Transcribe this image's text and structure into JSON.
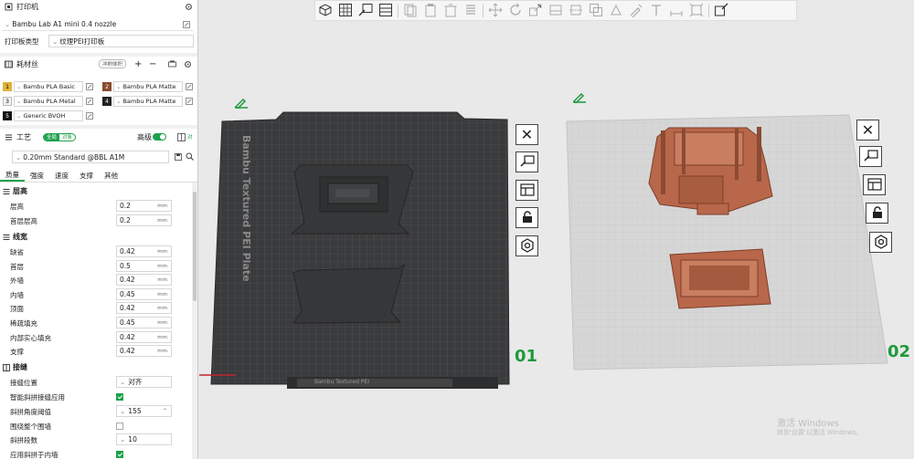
{
  "printer": {
    "title": "打印机",
    "printer_name": "Bambu Lab A1 mini 0.4 nozzle",
    "plate_type_label": "打印板类型",
    "plate_type_value": "纹理PEI打印板"
  },
  "filament": {
    "title": "耗材丝",
    "flush_badge": "冲刷体积",
    "items": [
      {
        "slot": "1",
        "name": "Bambu PLA Basic",
        "color": "#e0b33a"
      },
      {
        "slot": "2",
        "name": "Bambu PLA Matte",
        "color": "#8a4a2d"
      },
      {
        "slot": "3",
        "name": "Bambu PLA Metal",
        "color": "#f2f2f2"
      },
      {
        "slot": "4",
        "name": "Bambu PLA Matte",
        "color": "#222222"
      },
      {
        "slot": "5",
        "name": "Generic BVOH",
        "color": "#111111"
      }
    ]
  },
  "process": {
    "title": "工艺",
    "toggle_global": "全局",
    "toggle_object": "对象",
    "advanced_label": "高级",
    "profile": "0.20mm Standard @BBL A1M",
    "tabs": [
      "质量",
      "强度",
      "速度",
      "支撑",
      "其他"
    ],
    "groups": {
      "layer_height": "层高",
      "line_width": "线宽",
      "seam": "接缝"
    },
    "layer_params": [
      {
        "label": "层高",
        "value": "0.2",
        "unit": "mm"
      },
      {
        "label": "首层层高",
        "value": "0.2",
        "unit": "mm"
      }
    ],
    "width_params": [
      {
        "label": "缺省",
        "value": "0.42",
        "unit": "mm"
      },
      {
        "label": "首层",
        "value": "0.5",
        "unit": "mm"
      },
      {
        "label": "外墙",
        "value": "0.42",
        "unit": "mm"
      },
      {
        "label": "内墙",
        "value": "0.45",
        "unit": "mm"
      },
      {
        "label": "顶面",
        "value": "0.42",
        "unit": "mm"
      },
      {
        "label": "稀疏填充",
        "value": "0.45",
        "unit": "mm"
      },
      {
        "label": "内部实心填充",
        "value": "0.42",
        "unit": "mm"
      },
      {
        "label": "支撑",
        "value": "0.42",
        "unit": "mm"
      }
    ],
    "seam_params": {
      "position_label": "接缝位置",
      "position_value": "对齐",
      "smart_scarf_label": "智能斜拼接缝应用",
      "scarf_angle_label": "斜拼角度阈值",
      "scarf_angle_value": "155",
      "around_wall_label": "围绕整个围墙",
      "scarf_steps_label": "斜拼段数",
      "scarf_steps_value": "10",
      "inner_wall_label": "应用斜拼于内墙"
    }
  },
  "viewport": {
    "plate1_label": "Bambu Textured PEI Plate",
    "plate1_number": "01",
    "plate2_number": "02",
    "plate1_bottom_label": "Bambu Textured PEI",
    "watermark_title": "激活 Windows",
    "watermark_sub": "转到'设置'以激活 Windows。"
  },
  "colors": {
    "accent": "#1da14b",
    "plate_dark": "#3c3d3e",
    "plate_light": "#d9d9d9",
    "model_orange": "#b8674a"
  }
}
